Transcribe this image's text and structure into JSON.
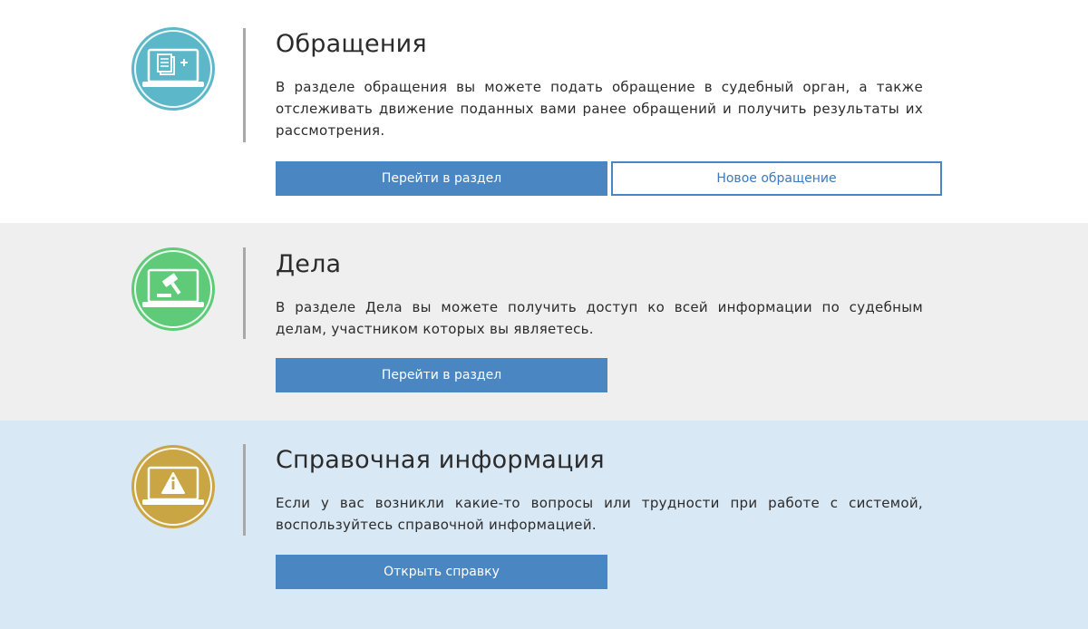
{
  "sections": [
    {
      "id": "appeals",
      "icon": "document-add-laptop-icon",
      "icon_color": "#5cb8c8",
      "title": "Обращения",
      "description": "В разделе обращения вы можете подать обращение в судебный орган, а также отслеживать движение поданных вами ранее обращений и получить результаты их рассмотрения.",
      "buttons": [
        {
          "label": "Перейти в раздел",
          "style": "primary"
        },
        {
          "label": "Новое обращение",
          "style": "outline"
        }
      ]
    },
    {
      "id": "cases",
      "icon": "gavel-laptop-icon",
      "icon_color": "#5fcb78",
      "title": "Дела",
      "description": "В разделе Дела вы можете получить доступ ко всей информации по судебным делам, участником которых вы являетесь.",
      "buttons": [
        {
          "label": "Перейти в раздел",
          "style": "primary"
        }
      ]
    },
    {
      "id": "help",
      "icon": "info-laptop-icon",
      "icon_color": "#c9a544",
      "title": "Справочная информация",
      "description": "Если у вас возникли какие-то вопросы или трудности при работе с системой, воспользуйтесь справочной информацией.",
      "buttons": [
        {
          "label": "Открыть справку",
          "style": "primary"
        }
      ]
    }
  ],
  "colors": {
    "button_primary": "#4a86c2",
    "divider": "#a8a8a8",
    "section_cases_bg": "#efefef",
    "section_help_bg": "#d9e8f5"
  }
}
